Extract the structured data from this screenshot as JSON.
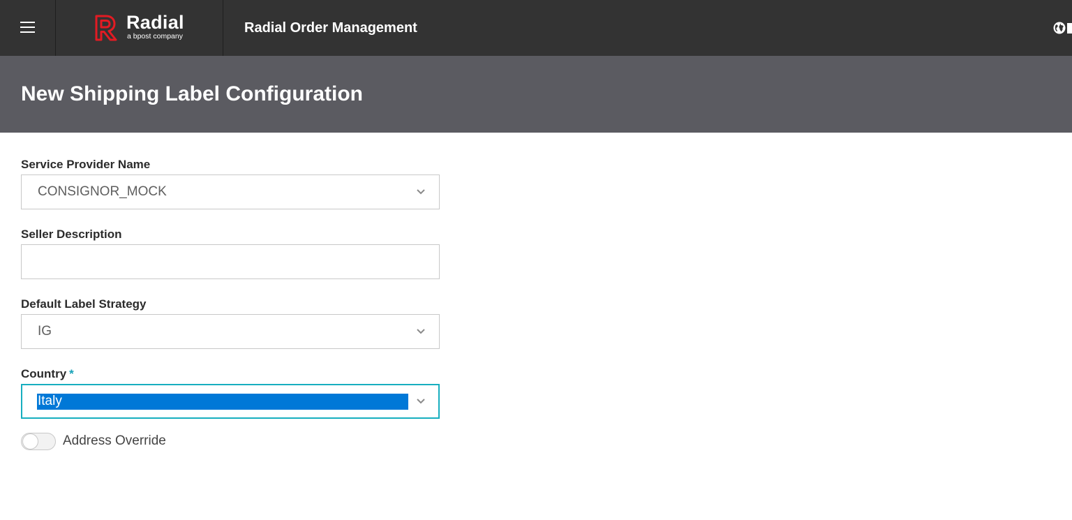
{
  "topbar": {
    "brand_name": "Radial",
    "brand_tagline": "a bpost company",
    "app_title": "Radial Order Management",
    "menu_icon": "hamburger-menu-icon",
    "globe_icon": "globe-icon",
    "brand_color": "#e31b23"
  },
  "page": {
    "title": "New Shipping Label Configuration"
  },
  "form": {
    "service_provider": {
      "label": "Service Provider Name",
      "value": "CONSIGNOR_MOCK"
    },
    "seller_description": {
      "label": "Seller Description",
      "value": ""
    },
    "default_label_strategy": {
      "label": "Default Label Strategy",
      "value": "IG"
    },
    "country": {
      "label": "Country",
      "required_mark": "*",
      "value": "Italy"
    },
    "address_override": {
      "label": "Address Override",
      "checked": false
    }
  },
  "colors": {
    "topbar_bg": "#333333",
    "header_bg": "#5b5b61",
    "focus_border": "#17aebf",
    "selection_bg": "#0078d7"
  }
}
